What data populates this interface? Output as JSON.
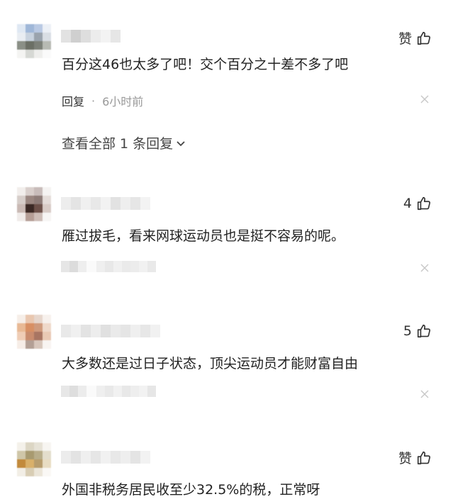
{
  "comments": [
    {
      "like_label": "赞",
      "text": "百分这46也太多了吧！交个百分之十差不多了吧",
      "reply_label": "回复",
      "time": "6小时前",
      "view_replies": "查看全部 1 条回复"
    },
    {
      "like_label": "4",
      "text": "雁过拔毛，看来网球运动员也是挺不容易的呢。"
    },
    {
      "like_label": "5",
      "text": "大多数还是过日子状态，顶尖运动员才能财富自由"
    },
    {
      "like_label": "赞",
      "text": "外国非税务居民收至少32.5%的税，正常呀"
    }
  ],
  "colors": {
    "text": "#222222",
    "meta": "#999999",
    "like": "#333333"
  }
}
